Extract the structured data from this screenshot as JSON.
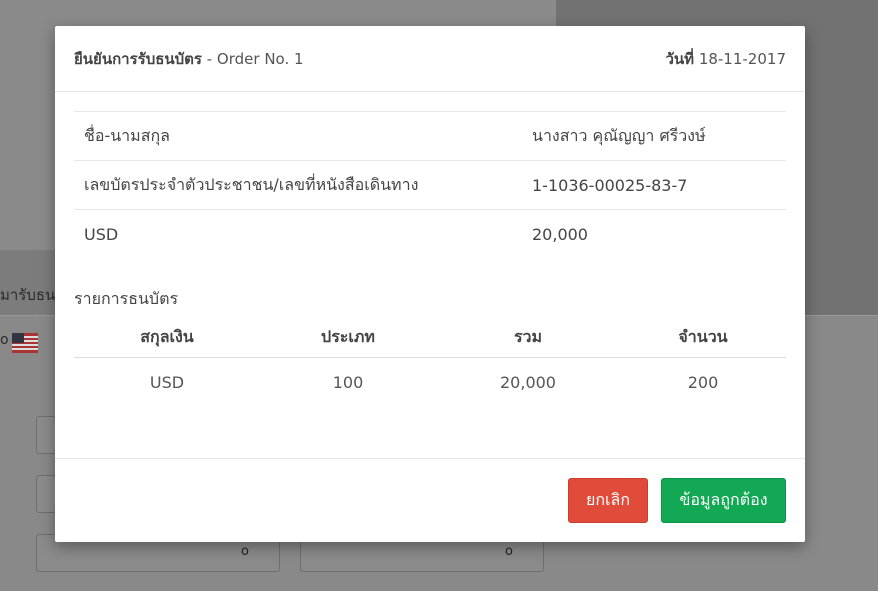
{
  "background": {
    "tab_text": "มารับธน",
    "currency_code": "o",
    "field_values": [
      "o",
      "o"
    ]
  },
  "modal": {
    "title_main": "ยืนยันการรับธนบัตร",
    "title_order": "- Order No. 1",
    "date_label": "วันที่",
    "date_value": "18-11-2017",
    "info_rows": [
      {
        "label": "ชื่อ-นามสกุล",
        "value": "นางสาว คุณัญญา ศรีวงษ์"
      },
      {
        "label": "เลขบัตรประจำตัวประชาชน/เลขที่หนังสือเดินทาง",
        "value": "1-1036-00025-83-7"
      },
      {
        "label": "USD",
        "value": "20,000"
      }
    ],
    "items_section_title": "รายการธนบัตร",
    "items_headers": [
      "สกุลเงิน",
      "ประเภท",
      "รวม",
      "จำนวน"
    ],
    "items_rows": [
      [
        "USD",
        "100",
        "20,000",
        "200"
      ]
    ],
    "buttons": {
      "cancel": "ยกเลิก",
      "confirm": "ข้อมูลถูกต้อง"
    },
    "colors": {
      "cancel": "#e04b3a",
      "confirm": "#12a854"
    }
  }
}
